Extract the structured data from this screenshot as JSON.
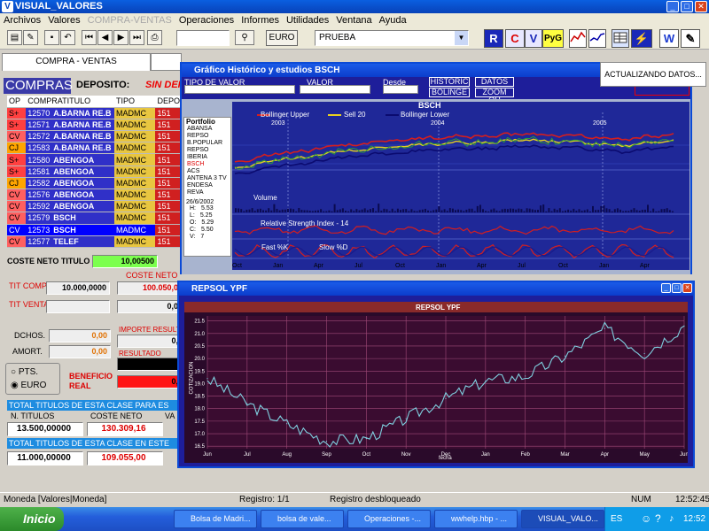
{
  "window": {
    "title": "VISUAL_VALORES",
    "min": "_",
    "max": "□",
    "close": "✕"
  },
  "menu": [
    {
      "label": "Archivos",
      "disabled": false
    },
    {
      "label": "Valores",
      "disabled": false
    },
    {
      "label": "COMPRA-VENTAS",
      "disabled": true
    },
    {
      "label": "Operaciones",
      "disabled": false
    },
    {
      "label": "Informes",
      "disabled": false
    },
    {
      "label": "Utilidades",
      "disabled": false
    },
    {
      "label": "Ventana",
      "disabled": false
    },
    {
      "label": "Ayuda",
      "disabled": false
    }
  ],
  "toolbar": {
    "currency_label": "EURO",
    "account_value": "PRUEBA",
    "search_value": "",
    "btn_r": "R",
    "btn_c": "C",
    "btn_v": "V",
    "btn_pyg": "PyG",
    "btn_w": "W"
  },
  "compra_tab": "COMPRA - VENTAS",
  "left": {
    "heading": "COMPRAS",
    "deposito_label": "DEPOSITO:",
    "deposito_value": "SIN DEPOS",
    "columns": [
      "OP",
      "COMPRATITULO",
      "TIPO",
      "DEPO"
    ],
    "rows": [
      {
        "op": "S+",
        "num": "12570",
        "name": "A.BARNA RE.B",
        "tipo": "MADMC",
        "depo": "151"
      },
      {
        "op": "S+",
        "num": "12571",
        "name": "A.BARNA RE.B",
        "tipo": "MADMC",
        "depo": "151"
      },
      {
        "op": "CV",
        "num": "12572",
        "name": "A.BARNA RE.B",
        "tipo": "MADMC",
        "depo": "151"
      },
      {
        "op": "CJ",
        "num": "12583",
        "name": "A.BARNA RE.B",
        "tipo": "MADMC",
        "depo": "151"
      },
      {
        "op": "S+",
        "num": "12580",
        "name": "ABENGOA",
        "tipo": "MADMC",
        "depo": "151"
      },
      {
        "op": "S+",
        "num": "12581",
        "name": "ABENGOA",
        "tipo": "MADMC",
        "depo": "151"
      },
      {
        "op": "CJ",
        "num": "12582",
        "name": "ABENGOA",
        "tipo": "MADMC",
        "depo": "151"
      },
      {
        "op": "CV",
        "num": "12576",
        "name": "ABENGOA",
        "tipo": "MADMC",
        "depo": "151"
      },
      {
        "op": "CV",
        "num": "12592",
        "name": "ABENGOA",
        "tipo": "MADMC",
        "depo": "151"
      },
      {
        "op": "CV",
        "num": "12579",
        "name": "BSCH",
        "tipo": "MADMC",
        "depo": "151"
      },
      {
        "op": "CV",
        "num": "12573",
        "name": "BSCH",
        "tipo": "MADMC",
        "depo": "151"
      },
      {
        "op": "CV",
        "num": "12577",
        "name": "TELEF",
        "tipo": "MADMC",
        "depo": "151"
      }
    ],
    "coste_neto_titulo_label": "COSTE NETO TITULO",
    "coste_neto_titulo_value": "10,00500",
    "coste_neto_label": "COSTE NETO",
    "tit_comp_label": "TIT COMP.",
    "tit_comp_value": "10.000,0000",
    "tit_comp_coste": "100.050,0",
    "tit_venta_label": "TIT VENTA",
    "tit_venta_value": "",
    "tit_venta_coste": "0,0",
    "dchos_label": "DCHOS.",
    "dchos_value": "0,00",
    "amort_label": "AMORT.",
    "amort_value": "0,00",
    "importe_label": "IMPORTE RESULT",
    "importe_value": "0,",
    "resultado_label": "RESULTADO",
    "resultado_value": "",
    "beneficio_label": "BENEFICIO REAL",
    "beneficio_value": "0,",
    "pts_label": "PTS.",
    "euro_label": "EURO",
    "total1_label": "TOTAL TITULOS DE ESTA CLASE PARA ES",
    "total_cols": [
      "N. TITULOS",
      "COSTE NETO",
      "VA"
    ],
    "total1_titulos": "13.500,00000",
    "total1_coste": "130.309,16",
    "total2_label": "TOTAL TITULOS DE ESTA CLASE EN ESTE",
    "total2_titulos": "11.000,00000",
    "total2_coste": "109.055,00"
  },
  "hist": {
    "title": "Gráfico Histórico y estudios BSCH",
    "tipo_label": "TIPO DE VALOR",
    "valor_label": "VALOR",
    "desde_label": "Desde",
    "buttons": [
      "HISTORIC",
      "DATOS",
      "BOLINGE",
      "ZOOM OU"
    ],
    "chart_title": "BSCH",
    "legend": [
      "Bollinger Upper",
      "Sell 20",
      "Bollinger Lower"
    ],
    "years": [
      "2003",
      "2004",
      "2005"
    ],
    "portfolio_title": "Portfolio",
    "portfolio": [
      "ABANSA",
      "REPSO",
      "B.POPULAR",
      "REPSO",
      "IBERIA",
      "BSCH",
      "ACS",
      "ANTENA 3 TV",
      "ENDESA",
      "REVA"
    ],
    "date": "26/6/2002",
    "ohlc": [
      {
        "k": "H:",
        "v": "5.53"
      },
      {
        "k": "L:",
        "v": "5.25"
      },
      {
        "k": "O:",
        "v": "5.29"
      },
      {
        "k": "C:",
        "v": "5.50"
      },
      {
        "k": "V:",
        "v": "7"
      }
    ],
    "volume_label": "Volume",
    "rsi_label": "Relative Strength Index - 14",
    "stoch_legend": [
      "Fast %K",
      "Slow %D"
    ],
    "months": [
      "Oct",
      "Jan",
      "Apr",
      "Jul",
      "Oct",
      "Jan",
      "Apr",
      "Jul",
      "Oct",
      "Jan",
      "Apr"
    ]
  },
  "notice": "ACTUALIZANDO DATOS...",
  "repsol": {
    "title": "REPSOL YPF",
    "chart_title": "REPSOL YPF",
    "ylabel": "COTIZACION",
    "xlabel": "fecha"
  },
  "chart_data": {
    "type": "line",
    "title": "REPSOL YPF",
    "ylabel": "COTIZACION",
    "xlabel": "fecha",
    "x": [
      "Jun",
      "Jul",
      "Aug",
      "Sep",
      "Oct",
      "Nov",
      "Dec",
      "Jan",
      "Feb",
      "Mar",
      "Apr",
      "May",
      "Jun"
    ],
    "yticks": [
      16.5,
      17.0,
      17.5,
      18.0,
      18.5,
      19.0,
      19.5,
      20.0,
      20.5,
      21.0,
      21.5
    ],
    "ylim": [
      16.4,
      21.7
    ],
    "series": [
      {
        "values": [
          19.2,
          18.2,
          17.4,
          16.7,
          16.8,
          17.6,
          18.4,
          19.1,
          19.3,
          20.1,
          21.2,
          20.2,
          21.3
        ]
      }
    ]
  },
  "status": {
    "left": "Moneda [Valores|Moneda]",
    "mid": "Registro: 1/1",
    "mid2": "Registro desbloqueado",
    "num": "NUM",
    "time": "12:52:45"
  },
  "taskbar": {
    "start": "Inicio",
    "tasks": [
      "Bolsa de Madri...",
      "bolsa de vale...",
      "Operaciones -...",
      "wwhelp.hbp - ...",
      "VISUAL_VALO..."
    ],
    "lang": "ES",
    "clock": "12:52"
  }
}
